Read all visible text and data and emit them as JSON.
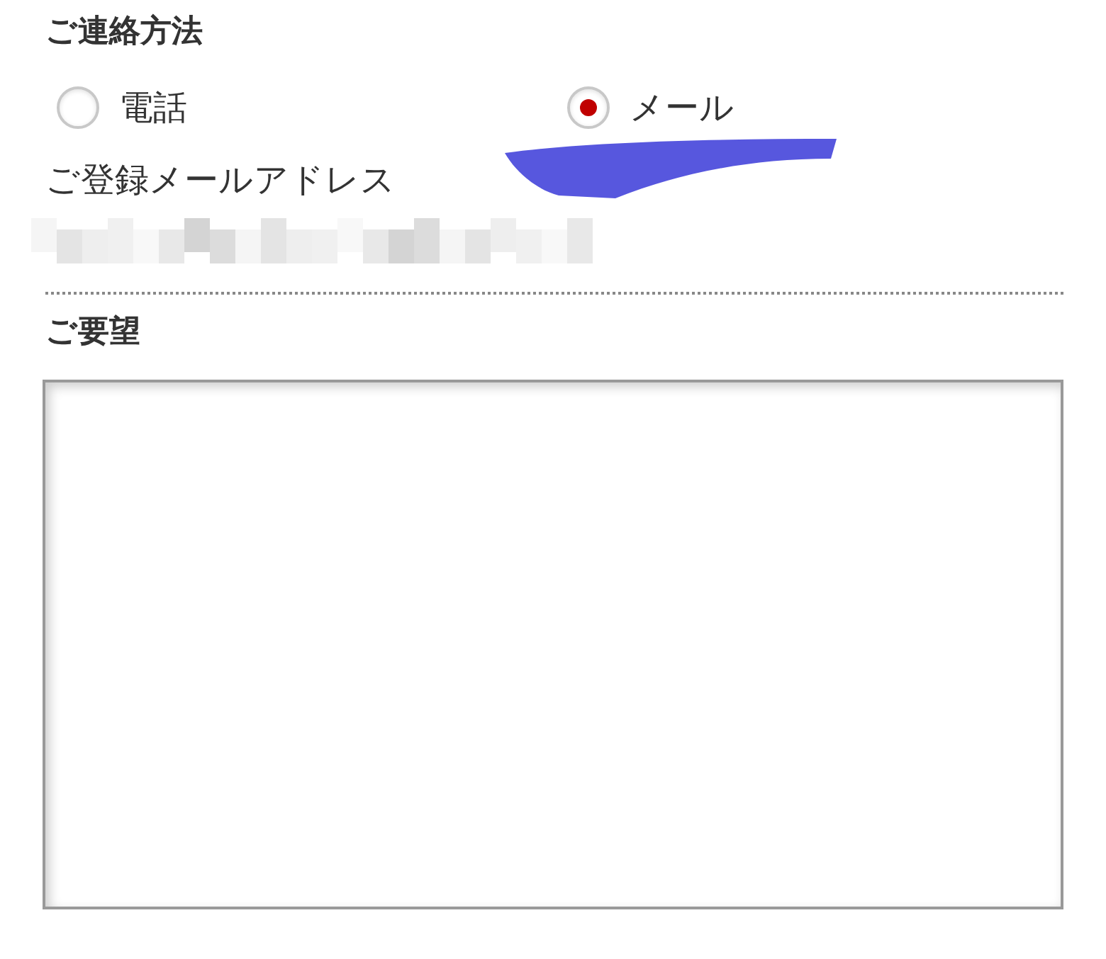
{
  "contact_method": {
    "heading": "ご連絡方法",
    "options": [
      {
        "label": "電話",
        "selected": false
      },
      {
        "label": "メール",
        "selected": true
      }
    ]
  },
  "email": {
    "label": "ご登録メールアドレス"
  },
  "request": {
    "heading": "ご要望"
  }
}
